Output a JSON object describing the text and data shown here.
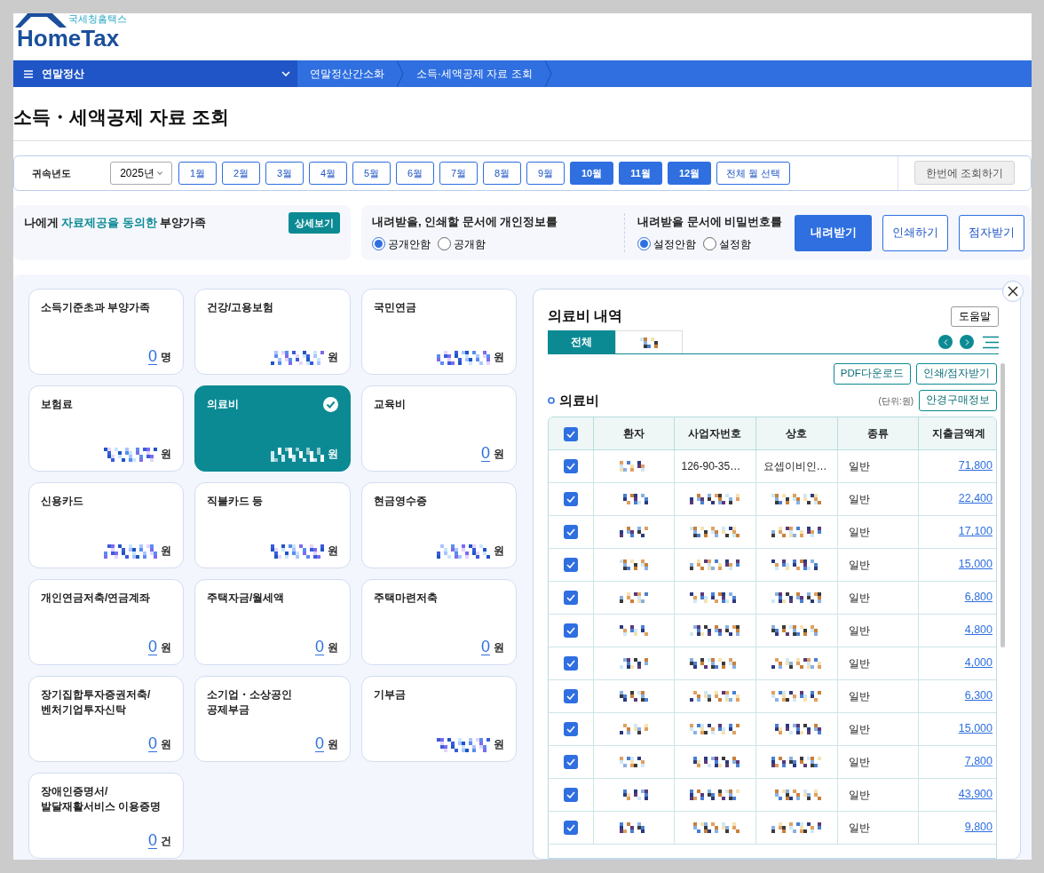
{
  "logo": {
    "subtitle": "국세청홈택스",
    "name": "HomeTax"
  },
  "nav": {
    "menu": "연말정산",
    "crumbs": [
      "연말정산간소화",
      "소득·세액공제 자료 조회"
    ]
  },
  "page_title": "소득・세액공제 자료 조회",
  "filter": {
    "label": "귀속년도",
    "year": "2025년",
    "months": [
      {
        "label": "1월",
        "selected": false
      },
      {
        "label": "2월",
        "selected": false
      },
      {
        "label": "3월",
        "selected": false
      },
      {
        "label": "4월",
        "selected": false
      },
      {
        "label": "5월",
        "selected": false
      },
      {
        "label": "6월",
        "selected": false
      },
      {
        "label": "7월",
        "selected": false
      },
      {
        "label": "8월",
        "selected": false
      },
      {
        "label": "9월",
        "selected": false
      },
      {
        "label": "10월",
        "selected": true
      },
      {
        "label": "11월",
        "selected": true
      },
      {
        "label": "12월",
        "selected": true
      }
    ],
    "all_months": "전체 월 선택",
    "query_all": "한번에 조회하기"
  },
  "consent": {
    "prefix": "나에게",
    "highlight": "자료제공을 동의한",
    "suffix": "부양가족",
    "button": "상세보기"
  },
  "options": [
    {
      "question": "내려받을, 인쇄할 문서에 개인정보를",
      "choices": [
        {
          "label": "공개안함",
          "selected": true
        },
        {
          "label": "공개함",
          "selected": false
        }
      ]
    },
    {
      "question": "내려받을 문서에 비밀번호를",
      "choices": [
        {
          "label": "설정안함",
          "selected": true
        },
        {
          "label": "설정함",
          "selected": false
        }
      ]
    }
  ],
  "actions": [
    {
      "label": "내려받기",
      "primary": true
    },
    {
      "label": "인쇄하기",
      "primary": false
    },
    {
      "label": "점자받기",
      "primary": false
    }
  ],
  "cards": [
    {
      "title": "소득기준초과 부양가족",
      "amount": "0",
      "unit": "명",
      "selected": false
    },
    {
      "title": "건강/고용보험",
      "unit": "원",
      "selected": false
    },
    {
      "title": "국민연금",
      "unit": "원",
      "selected": false
    },
    {
      "title": "보험료",
      "unit": "원",
      "selected": false
    },
    {
      "title": "의료비",
      "unit": "원",
      "selected": true
    },
    {
      "title": "교육비",
      "amount": "0",
      "unit": "원",
      "selected": false
    },
    {
      "title": "신용카드",
      "unit": "원",
      "selected": false
    },
    {
      "title": "직불카드 등",
      "unit": "원",
      "selected": false
    },
    {
      "title": "현금영수증",
      "unit": "원",
      "selected": false
    },
    {
      "title": "개인연금저축/연금계좌",
      "amount": "0",
      "unit": "원",
      "selected": false
    },
    {
      "title": "주택자금/월세액",
      "amount": "0",
      "unit": "원",
      "selected": false
    },
    {
      "title": "주택마련저축",
      "amount": "0",
      "unit": "원",
      "selected": false
    },
    {
      "title": "장기집합투자증권저축/\n벤처기업투자신탁",
      "amount": "0",
      "unit": "원",
      "selected": false
    },
    {
      "title": "소기업・소상공인\n공제부금",
      "amount": "0",
      "unit": "원",
      "selected": false
    },
    {
      "title": "기부금",
      "unit": "원",
      "selected": false
    },
    {
      "title": "장애인증명서/\n발달재활서비스 이용증명",
      "amount": "0",
      "unit": "건",
      "selected": false
    }
  ],
  "detail": {
    "title": "의료비 내역",
    "help": "도움말",
    "tabs": [
      {
        "label": "전체",
        "selected": true
      },
      {
        "selected": false
      }
    ],
    "buttons": [
      "PDF다운로드",
      "인쇄/점자받기"
    ],
    "section": "의료비",
    "unit_note": "(단위:원)",
    "glasses_button": "안경구매정보",
    "header_checked": true,
    "columns": [
      "환자",
      "사업자번호",
      "상호",
      "종류",
      "지출금액계"
    ],
    "rows": [
      {
        "checked": true,
        "business_no": "126-90-35…",
        "name": "요셉이비인…",
        "type": "일반",
        "amount": "71,800"
      },
      {
        "checked": true,
        "type": "일반",
        "amount": "22,400"
      },
      {
        "checked": true,
        "type": "일반",
        "amount": "17,100"
      },
      {
        "checked": true,
        "type": "일반",
        "amount": "15,000"
      },
      {
        "checked": true,
        "type": "일반",
        "amount": "6,800"
      },
      {
        "checked": true,
        "type": "일반",
        "amount": "4,800"
      },
      {
        "checked": true,
        "type": "일반",
        "amount": "4,000"
      },
      {
        "checked": true,
        "type": "일반",
        "amount": "6,300"
      },
      {
        "checked": true,
        "type": "일반",
        "amount": "15,000"
      },
      {
        "checked": true,
        "type": "일반",
        "amount": "7,800"
      },
      {
        "checked": true,
        "type": "일반",
        "amount": "43,900"
      },
      {
        "checked": true,
        "type": "일반",
        "amount": "9,800"
      }
    ]
  }
}
